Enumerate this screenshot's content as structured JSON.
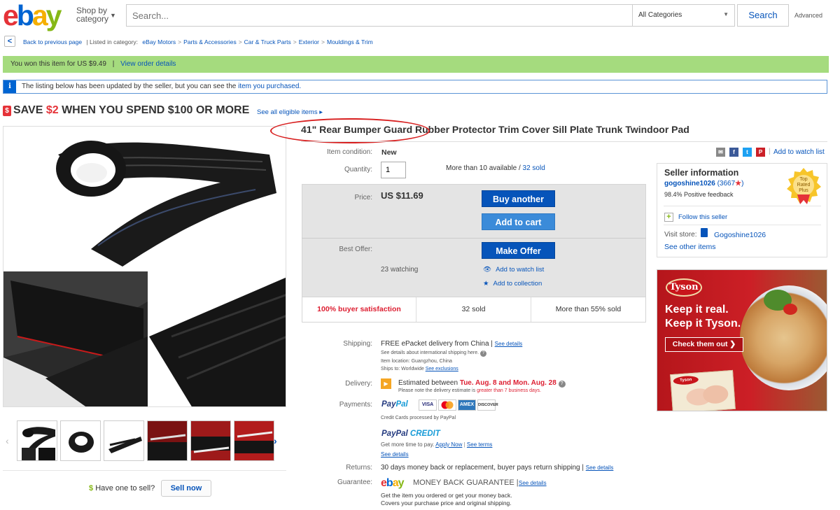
{
  "header": {
    "logo": [
      "e",
      "b",
      "a",
      "y"
    ],
    "shop_by": "Shop by category",
    "search_placeholder": "Search...",
    "category": "All Categories",
    "search_button": "Search",
    "advanced": "Advanced"
  },
  "breadcrumb": {
    "back": "Back to previous page",
    "listed_in": "| Listed in category:",
    "items": [
      "eBay Motors",
      "Parts & Accessories",
      "Car & Truck Parts",
      "Exterior",
      "Mouldings & Trim"
    ]
  },
  "won_banner": {
    "text": "You won this item for US $9.49",
    "separator": "|",
    "link": "View order details"
  },
  "info_banner": {
    "icon": "i",
    "text": "The listing below has been updated by the seller, but you can see the",
    "link": "item you purchased."
  },
  "promo": {
    "icon": "$",
    "prefix": "SAVE ",
    "amount": "$2",
    "suffix": " WHEN YOU SPEND $100 OR MORE",
    "link": "See all eligible items ▸"
  },
  "item": {
    "title": "41\" Rear Bumper Guard Rubber Protector Trim Cover Sill Plate Trunk Twindoor Pad",
    "condition_label": "Item condition:",
    "condition": "New",
    "quantity_label": "Quantity:",
    "quantity": "1",
    "available": "More than 10 available /",
    "sold_link": "32 sold",
    "price_label": "Price:",
    "price": "US $11.69",
    "buy_another": "Buy another",
    "add_to_cart": "Add to cart",
    "best_offer_label": "Best Offer:",
    "make_offer": "Make Offer",
    "watching": "23 watching",
    "add_watch": "Add to watch list",
    "add_collection": "Add to collection",
    "stats": [
      "100% buyer satisfaction",
      "32 sold",
      "More than 55% sold"
    ]
  },
  "details": {
    "shipping_label": "Shipping:",
    "shipping_free": "FREE",
    "shipping_text": "ePacket delivery from China |",
    "shipping_see": "See details",
    "shipping_sub1": "See details about international shipping here.",
    "shipping_sub2": "Item location:  Guangzhou, China",
    "shipping_sub3": "Ships to:  Worldwide",
    "shipping_sub3_link": "See exclusions",
    "delivery_label": "Delivery:",
    "delivery_prefix": "Estimated between ",
    "delivery_dates": "Tue. Aug. 8 and Mon. Aug. 28",
    "delivery_note_prefix": "Please note the delivery estimate is ",
    "delivery_note_strong": "greater than 7 business days.",
    "payments_label": "Payments:",
    "paypal": [
      "Pay",
      "Pal"
    ],
    "cards": [
      "VISA",
      "MC",
      "AMEX",
      "DISCOVER"
    ],
    "cards_note": "Credit Cards processed by PayPal",
    "pp_credit": [
      "PayPal ",
      "CREDIT"
    ],
    "pp_credit_text": "Get more time to pay.",
    "apply_now": "Apply Now",
    "see_terms": "See terms",
    "pp_see_details": "See details",
    "returns_label": "Returns:",
    "returns_text": "30 days money back or replacement, buyer pays return shipping |",
    "returns_see": "See details",
    "guarantee_label": "Guarantee:",
    "mbg_logo": [
      "e",
      "b",
      "a",
      "y"
    ],
    "mbg_text": "MONEY BACK GUARANTEE  |",
    "mbg_see": "See details",
    "mbg_line1": "Get the item you ordered or get your money back.",
    "mbg_line2": "Covers your purchase price and original shipping."
  },
  "sell": {
    "dollar": "$",
    "text": "Have one to sell?",
    "button": "Sell now"
  },
  "share": {
    "separator": "|",
    "watchlist": "Add to watch list"
  },
  "seller": {
    "title": "Seller information",
    "name": "gogoshine1026",
    "score": "(3667",
    "star": "★",
    "close": ")",
    "feedback": "98.4% Positive feedback",
    "top_rated": [
      "Top",
      "Rated",
      "Plus"
    ],
    "follow": "Follow this seller",
    "visit_store": "Visit store:",
    "store_name": "Gogoshine1026",
    "other_items": "See other items"
  },
  "ad": {
    "logo": "Tyson",
    "line1": "Keep it real.",
    "line2": "Keep it Tyson.",
    "cta": "Check them out ❯",
    "pkg_logo": "Tyson"
  },
  "thumbs": {
    "prev": "‹",
    "next": "›"
  },
  "colors": {
    "ebay_red": "#e53238",
    "ebay_blue": "#0064d2",
    "ebay_yellow": "#f5af02",
    "ebay_green": "#86b817",
    "won_banner": "#a5db7e",
    "link": "#0654ba",
    "button": "#0654ba"
  }
}
